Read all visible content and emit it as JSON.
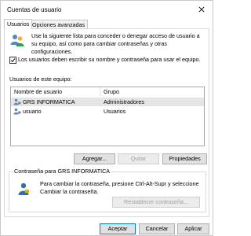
{
  "window": {
    "title": "Cuentas de usuario"
  },
  "tabs": [
    {
      "label": "Usuarios",
      "active": true
    },
    {
      "label": "Opciones avanzadas",
      "active": false
    }
  ],
  "intro_text": "Use la siguiente lista para conceder o denegar acceso de usuario a su equipo, así como para cambiar contraseñas y otras configuraciones.",
  "require_password": {
    "label": "Los usuarios deben escribir su nombre y contraseña para usar el equipo.",
    "checked": true
  },
  "users_section": {
    "label": "Usuarios de este equipo:",
    "columns": [
      "Nombre de usuario",
      "Grupo"
    ],
    "rows": [
      {
        "name": "GRS INFORMATICA",
        "group": "Administradores",
        "selected": true
      },
      {
        "name": "usuario",
        "group": "Usuarios",
        "selected": false
      }
    ]
  },
  "buttons": {
    "add": "Agregar...",
    "remove": "Quitar",
    "properties": "Propiedades",
    "reset_password": "Restablecer contraseña...",
    "ok": "Aceptar",
    "cancel": "Cancelar",
    "apply": "Aplicar"
  },
  "password_section": {
    "title": "Contraseña para GRS INFORMATICA",
    "text": "Para cambiar la contraseña, presione Ctrl-Alt-Supr y seleccione Cambiar la contraseña."
  },
  "icons": {
    "close": "close-icon",
    "users": "users-icon",
    "user_row": "user-icon",
    "person": "person-icon"
  },
  "colors": {
    "selected_row": "#e5e5e5",
    "accent": "#0078d7"
  }
}
